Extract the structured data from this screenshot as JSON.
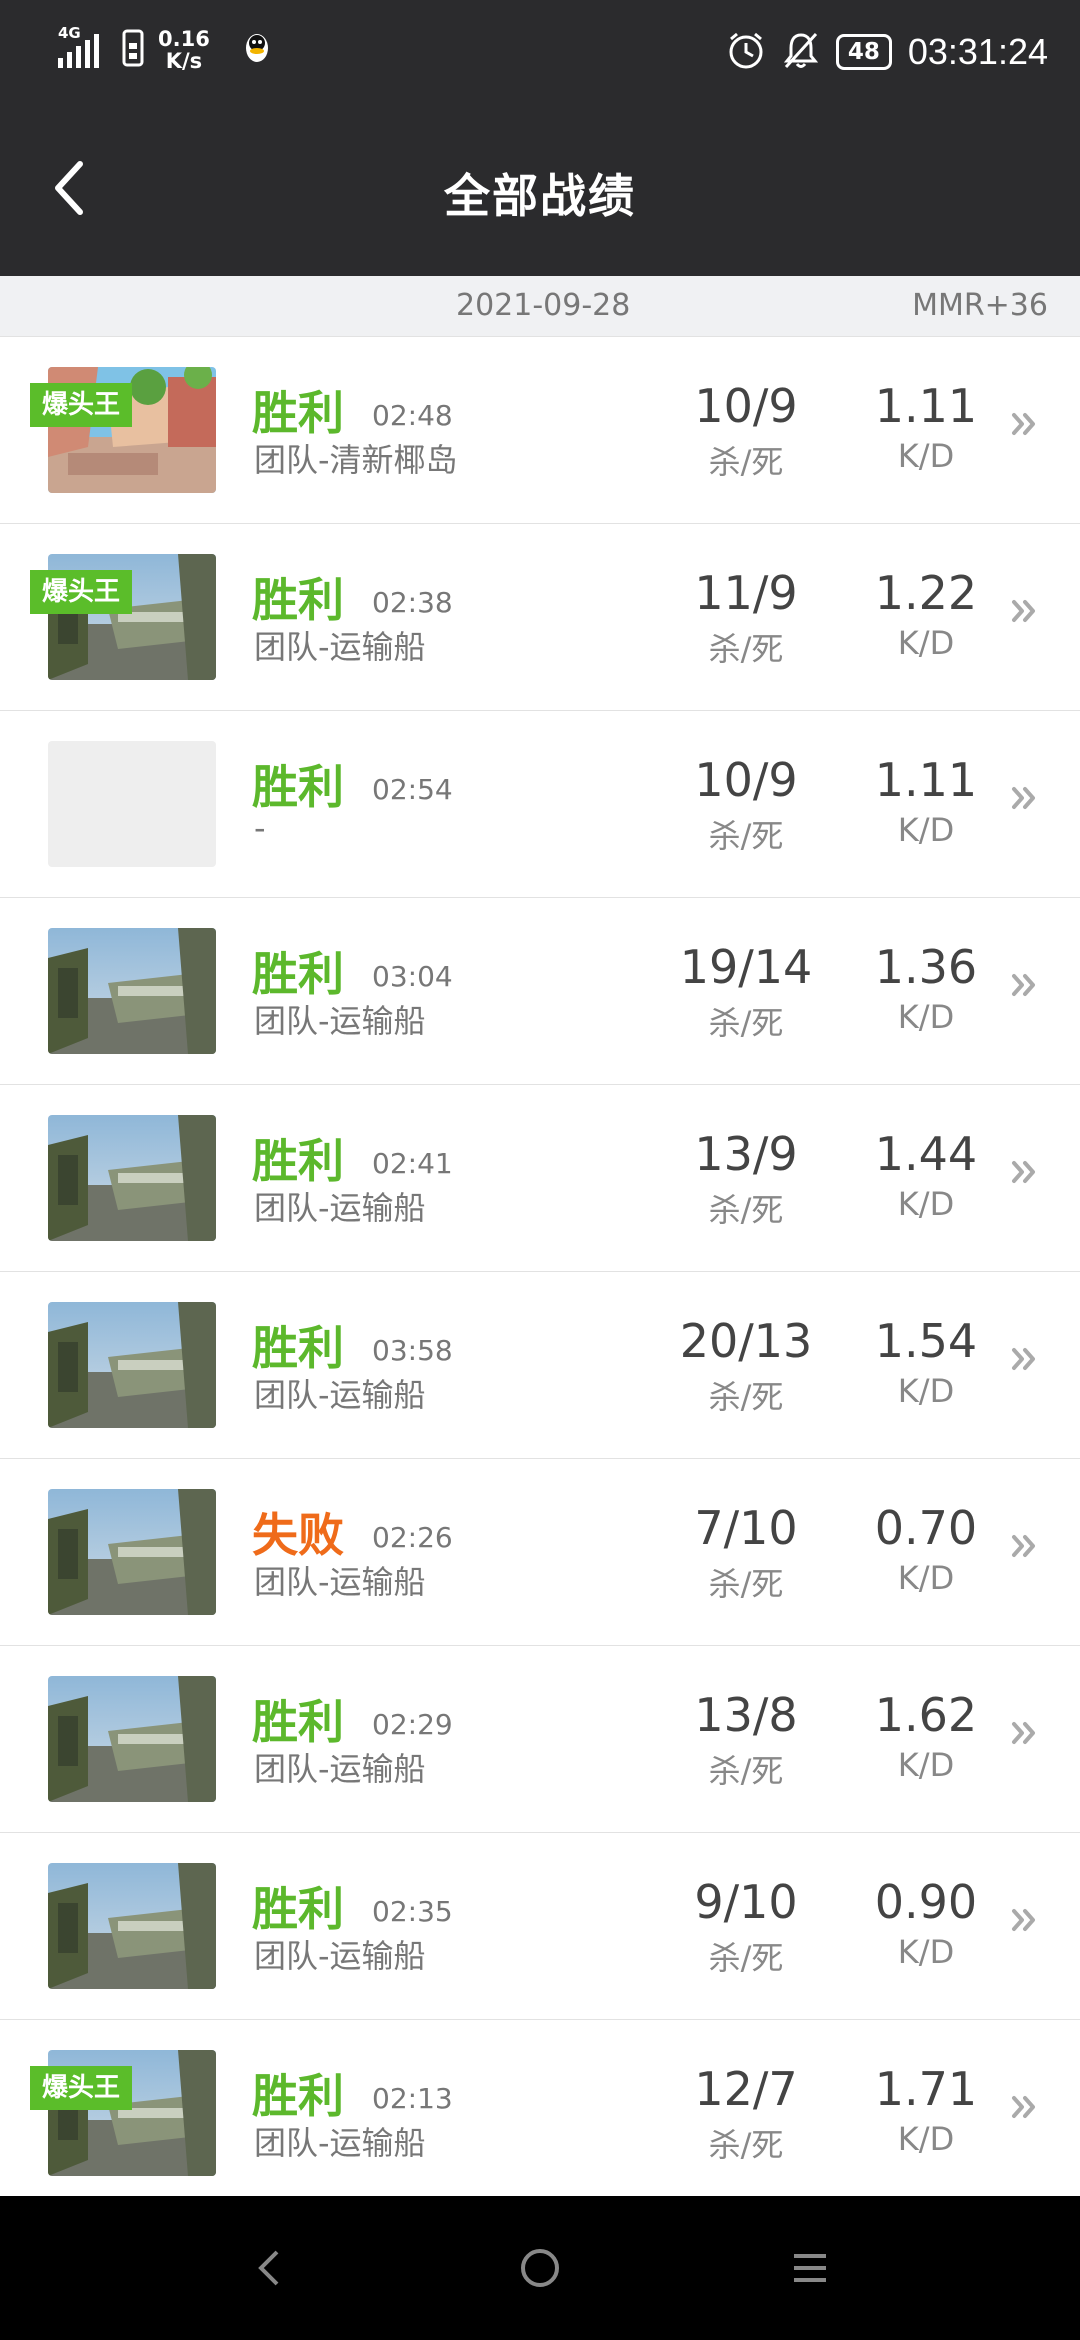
{
  "status_bar": {
    "network": "4G",
    "speed_value": "0.16",
    "speed_unit": "K/s",
    "battery": "48",
    "time": "03:31:24",
    "icons": [
      "signal-icon",
      "sim-icon",
      "qq-icon",
      "alarm-icon",
      "bell-muted-icon",
      "battery-icon"
    ]
  },
  "header": {
    "title": "全部战绩",
    "back_icon": "chevron-left-icon"
  },
  "date_bar": {
    "date": "2021-09-28",
    "mmr": "MMR+36"
  },
  "matches": [
    {
      "badge": "爆头王",
      "result": "胜利",
      "result_type": "win",
      "duration": "02:48",
      "mode_map": "团队-清新椰岛",
      "kd": "10/9",
      "kd_label": "杀/死",
      "ratio": "1.11",
      "ratio_label": "K/D",
      "thumb": "island"
    },
    {
      "badge": "爆头王",
      "result": "胜利",
      "result_type": "win",
      "duration": "02:38",
      "mode_map": "团队-运输船",
      "kd": "11/9",
      "kd_label": "杀/死",
      "ratio": "1.22",
      "ratio_label": "K/D",
      "thumb": "ship"
    },
    {
      "badge": "",
      "result": "胜利",
      "result_type": "win",
      "duration": "02:54",
      "mode_map": "-",
      "kd": "10/9",
      "kd_label": "杀/死",
      "ratio": "1.11",
      "ratio_label": "K/D",
      "thumb": "blank"
    },
    {
      "badge": "",
      "result": "胜利",
      "result_type": "win",
      "duration": "03:04",
      "mode_map": "团队-运输船",
      "kd": "19/14",
      "kd_label": "杀/死",
      "ratio": "1.36",
      "ratio_label": "K/D",
      "thumb": "ship"
    },
    {
      "badge": "",
      "result": "胜利",
      "result_type": "win",
      "duration": "02:41",
      "mode_map": "团队-运输船",
      "kd": "13/9",
      "kd_label": "杀/死",
      "ratio": "1.44",
      "ratio_label": "K/D",
      "thumb": "ship"
    },
    {
      "badge": "",
      "result": "胜利",
      "result_type": "win",
      "duration": "03:58",
      "mode_map": "团队-运输船",
      "kd": "20/13",
      "kd_label": "杀/死",
      "ratio": "1.54",
      "ratio_label": "K/D",
      "thumb": "ship"
    },
    {
      "badge": "",
      "result": "失败",
      "result_type": "lose",
      "duration": "02:26",
      "mode_map": "团队-运输船",
      "kd": "7/10",
      "kd_label": "杀/死",
      "ratio": "0.70",
      "ratio_label": "K/D",
      "thumb": "ship"
    },
    {
      "badge": "",
      "result": "胜利",
      "result_type": "win",
      "duration": "02:29",
      "mode_map": "团队-运输船",
      "kd": "13/8",
      "kd_label": "杀/死",
      "ratio": "1.62",
      "ratio_label": "K/D",
      "thumb": "ship"
    },
    {
      "badge": "",
      "result": "胜利",
      "result_type": "win",
      "duration": "02:35",
      "mode_map": "团队-运输船",
      "kd": "9/10",
      "kd_label": "杀/死",
      "ratio": "0.90",
      "ratio_label": "K/D",
      "thumb": "ship"
    },
    {
      "badge": "爆头王",
      "result": "胜利",
      "result_type": "win",
      "duration": "02:13",
      "mode_map": "团队-运输船",
      "kd": "12/7",
      "kd_label": "杀/死",
      "ratio": "1.71",
      "ratio_label": "K/D",
      "thumb": "ship"
    }
  ],
  "colors": {
    "win": "#5cb82c",
    "lose": "#ef6b1a",
    "badge": "#5bbd2a",
    "header_bg": "#2b2b2d"
  },
  "nav_bar": {
    "icons": [
      "nav-back-icon",
      "nav-home-icon",
      "nav-menu-icon"
    ]
  }
}
